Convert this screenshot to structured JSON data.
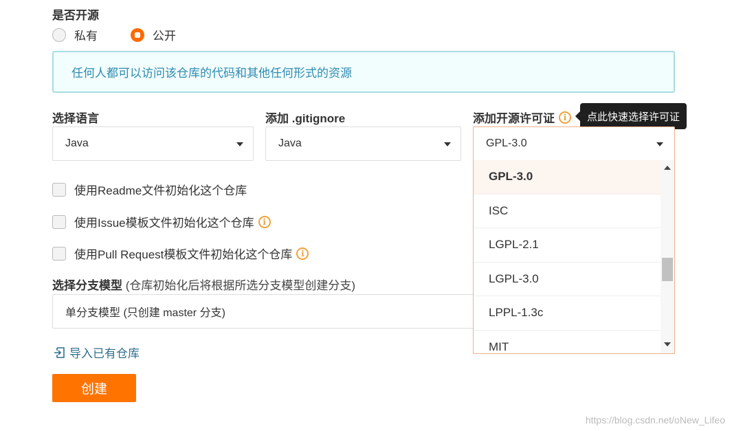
{
  "visibility": {
    "label": "是否开源",
    "options": [
      {
        "label": "私有",
        "checked": false
      },
      {
        "label": "公开",
        "checked": true
      }
    ],
    "notice": "任何人都可以访问该仓库的代码和其他任何形式的资源"
  },
  "language": {
    "label": "选择语言",
    "value": "Java"
  },
  "gitignore": {
    "label": "添加 .gitignore",
    "value": "Java"
  },
  "license": {
    "label": "添加开源许可证",
    "tooltip": "点此快速选择许可证",
    "value": "GPL-3.0",
    "options": [
      "GPL-3.0",
      "ISC",
      "LGPL-2.1",
      "LGPL-3.0",
      "LPPL-1.3c",
      "MIT"
    ],
    "active_index": 0
  },
  "init_options": [
    {
      "label": "使用Readme文件初始化这个仓库",
      "checked": false,
      "info": false
    },
    {
      "label": "使用Issue模板文件初始化这个仓库",
      "checked": false,
      "info": true
    },
    {
      "label": "使用Pull Request模板文件初始化这个仓库",
      "checked": false,
      "info": true
    }
  ],
  "branch_model": {
    "label": "选择分支模型",
    "hint": "(仓库初始化后将根据所选分支模型创建分支)",
    "value": "单分支模型 (只创建 master 分支)"
  },
  "import_link": "导入已有仓库",
  "create_button": "创建",
  "watermark": "https://blog.csdn.net/oNew_Lifeo",
  "colors": {
    "accent": "#ff7300",
    "notice_border": "#a7dde3",
    "notice_text": "#2f8bb0",
    "info_icon": "#f0a23c"
  },
  "icons": {
    "info": "info-circle-icon",
    "import": "import-icon",
    "dropdown": "caret-down-icon"
  }
}
